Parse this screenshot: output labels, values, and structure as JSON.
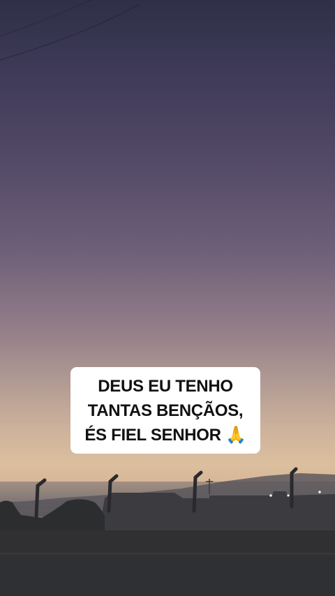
{
  "caption": {
    "line1": "DEUS EU TENHO",
    "line2": "TANTAS BENÇÃOS,",
    "line3": "ÉS FIEL SENHOR 🙏"
  },
  "colors": {
    "sky_top": "#2f3047",
    "sky_mid": "#8f7a87",
    "horizon_glow": "#dbbf9e",
    "ground": "#2e2f32",
    "caption_bg": "#ffffff",
    "caption_text": "#111111"
  }
}
